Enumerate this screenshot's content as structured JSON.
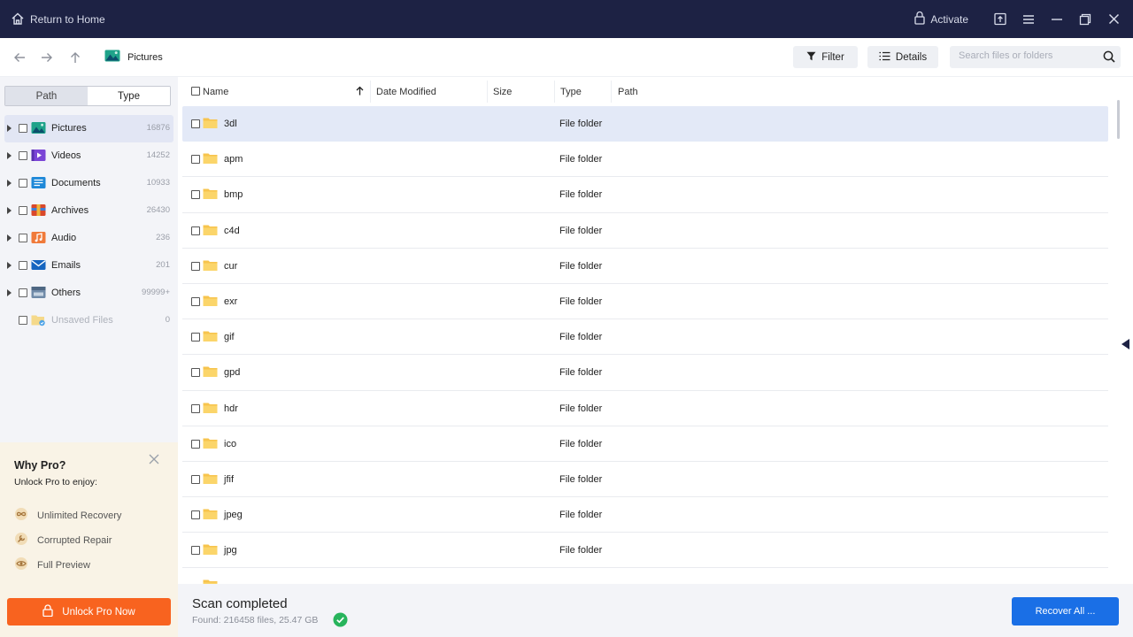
{
  "titlebar": {
    "home_label": "Return to Home",
    "activate_label": "Activate",
    "bg_color": "#1d2244",
    "icons": [
      "home-icon",
      "lock-icon",
      "upload-icon",
      "menu-icon",
      "minimize-icon",
      "restore-icon",
      "close-icon"
    ]
  },
  "nav": {
    "breadcrumb": "Pictures",
    "filter_label": "Filter",
    "details_label": "Details",
    "search_placeholder": "Search files or folders"
  },
  "sidebar": {
    "tabs": {
      "path": "Path",
      "type": "Type",
      "selected": "Type"
    },
    "categories": [
      {
        "label": "Pictures",
        "count": "16876",
        "icon": "pictures-icon",
        "active": true
      },
      {
        "label": "Videos",
        "count": "14252",
        "icon": "videos-icon"
      },
      {
        "label": "Documents",
        "count": "10933",
        "icon": "documents-icon"
      },
      {
        "label": "Archives",
        "count": "26430",
        "icon": "archives-icon"
      },
      {
        "label": "Audio",
        "count": "236",
        "icon": "audio-icon"
      },
      {
        "label": "Emails",
        "count": "201",
        "icon": "emails-icon"
      },
      {
        "label": "Others",
        "count": "99999+",
        "icon": "others-icon"
      },
      {
        "label": "Unsaved Files",
        "count": "0",
        "icon": "unsaved-files-icon",
        "disabled": true
      }
    ]
  },
  "promo": {
    "title": "Why Pro?",
    "subtitle": "Unlock Pro to enjoy:",
    "features": [
      "Unlimited Recovery",
      "Corrupted Repair",
      "Full Preview"
    ],
    "button_label": "Unlock Pro Now",
    "accent": "#f8631f"
  },
  "table": {
    "columns": [
      "Name",
      "Date Modified",
      "Size",
      "Type",
      "Path"
    ],
    "sort_column": "Name",
    "rows": [
      {
        "name": "3dl",
        "type": "File folder",
        "selected": true
      },
      {
        "name": "apm",
        "type": "File folder"
      },
      {
        "name": "bmp",
        "type": "File folder"
      },
      {
        "name": "c4d",
        "type": "File folder"
      },
      {
        "name": "cur",
        "type": "File folder"
      },
      {
        "name": "exr",
        "type": "File folder"
      },
      {
        "name": "gif",
        "type": "File folder"
      },
      {
        "name": "gpd",
        "type": "File folder"
      },
      {
        "name": "hdr",
        "type": "File folder"
      },
      {
        "name": "ico",
        "type": "File folder"
      },
      {
        "name": "jfif",
        "type": "File folder"
      },
      {
        "name": "jpeg",
        "type": "File folder"
      },
      {
        "name": "jpg",
        "type": "File folder"
      },
      {
        "name": "",
        "type": ""
      }
    ]
  },
  "footer": {
    "status": "Scan completed",
    "found": "Found: 216458 files, 25.47 GB",
    "recover_label": "Recover All ...",
    "recover_color": "#1a6fe6"
  }
}
